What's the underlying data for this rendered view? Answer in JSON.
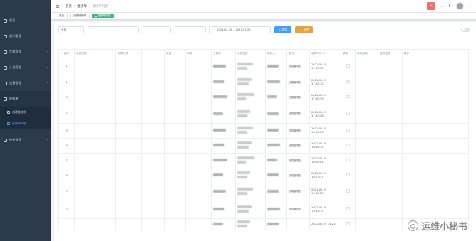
{
  "sidebar": {
    "brand": "",
    "items": [
      {
        "label": "首页",
        "icon": "home-icon"
      },
      {
        "label": "部门管理",
        "icon": "department-icon"
      },
      {
        "label": "字典管理",
        "icon": "dictionary-icon"
      },
      {
        "label": "人员管理",
        "icon": "user-icon"
      },
      {
        "label": "设备管理",
        "icon": "device-icon"
      },
      {
        "label": "维修单",
        "icon": "repair-order-icon"
      }
    ],
    "subitems": [
      {
        "label": "创建维修单"
      },
      {
        "label": "维修单列表"
      }
    ],
    "extra": {
      "label": "统计管理",
      "icon": "statistics-icon"
    }
  },
  "navbar": {
    "crumbs": [
      "首页",
      "维修单",
      "维修单列表"
    ]
  },
  "tags": [
    "首页",
    "创建维修单",
    "维修单列表"
  ],
  "filters": {
    "status": "全部",
    "department_placeholder": "",
    "type_placeholder": "",
    "keyword_placeholder": "",
    "date_start": "2021-02-25",
    "date_sep": "-",
    "date_end": "2021-02-25",
    "search_label": "搜索",
    "export_label": "导出"
  },
  "switch_label": "",
  "columns": [
    "编号",
    "维修类型",
    "报修方式",
    "",
    "设备",
    "状态",
    "工程师",
    "维修描述",
    "报修人",
    "部门",
    "维修时间",
    "紧急",
    "维修结果",
    "报修截图",
    "操作"
  ],
  "rows": [
    {
      "id": "1",
      "type": "",
      "method": "",
      "c4": "",
      "equip": "",
      "status": "",
      "dept": "信息管理处",
      "time": "2021-02-25 17:30:32",
      "result": "",
      "shot": "",
      "ops": ""
    },
    {
      "id": "2",
      "type": "",
      "method": "",
      "c4": "",
      "equip": "",
      "status": "",
      "dept": "信息管理处",
      "time": "2021-02-25 17:20:12",
      "result": "",
      "shot": "",
      "ops": ""
    },
    {
      "id": "3",
      "type": "",
      "method": "",
      "c4": "",
      "equip": "",
      "status": "",
      "dept": "信息管理处",
      "time": "2021-02-25 17:00:39",
      "result": "",
      "shot": "",
      "ops": ""
    },
    {
      "id": "4",
      "type": "",
      "method": "",
      "c4": "",
      "equip": "",
      "status": "",
      "dept": "信息管理处",
      "time": "2021-02-25 17:00:26",
      "result": "",
      "shot": "",
      "ops": ""
    },
    {
      "id": "5",
      "type": "",
      "method": "",
      "c4": "",
      "equip": "",
      "status": "",
      "dept": "信息管理处",
      "time": "2021-02-25 16:50:03",
      "result": "",
      "shot": "",
      "ops": ""
    },
    {
      "id": "6",
      "type": "",
      "method": "",
      "c4": "",
      "equip": "",
      "status": "",
      "dept": "信息管理处",
      "time": "2021-02-25 16:40:15",
      "result": "",
      "shot": "",
      "ops": ""
    },
    {
      "id": "7",
      "type": "",
      "method": "",
      "c4": "",
      "equip": "",
      "status": "",
      "dept": "信息管理处",
      "time": "2021-02-25 16:40:04",
      "result": "",
      "shot": "",
      "ops": ""
    },
    {
      "id": "8",
      "type": "",
      "method": "",
      "c4": "",
      "equip": "",
      "status": "",
      "dept": "信息管理处",
      "time": "2021-02-25 16:17:37",
      "result": "",
      "shot": "",
      "ops": ""
    },
    {
      "id": "9",
      "type": "",
      "method": "",
      "c4": "",
      "equip": "",
      "status": "",
      "dept": "信息管理处",
      "time": "2021-02-25 15:40:25",
      "result": "",
      "shot": "",
      "ops": ""
    },
    {
      "id": "10",
      "type": "",
      "method": "",
      "c4": "",
      "equip": "",
      "status": "",
      "dept": "信息管理处",
      "time": "2021-02-25 15:31:17",
      "result": "",
      "shot": "",
      "ops": ""
    },
    {
      "id": "",
      "type": "",
      "method": "",
      "c4": "",
      "equip": "",
      "status": "",
      "dept": "",
      "time": "2021-02-25 15:21:",
      "result": "",
      "shot": "",
      "ops": ""
    }
  ],
  "watermark": "运维小秘书",
  "colors": {
    "sidebar": "#2d3a4b",
    "accent": "#409eff",
    "tag_active": "#42b983",
    "export": "#e6a23c",
    "danger": "#f56c6c"
  }
}
